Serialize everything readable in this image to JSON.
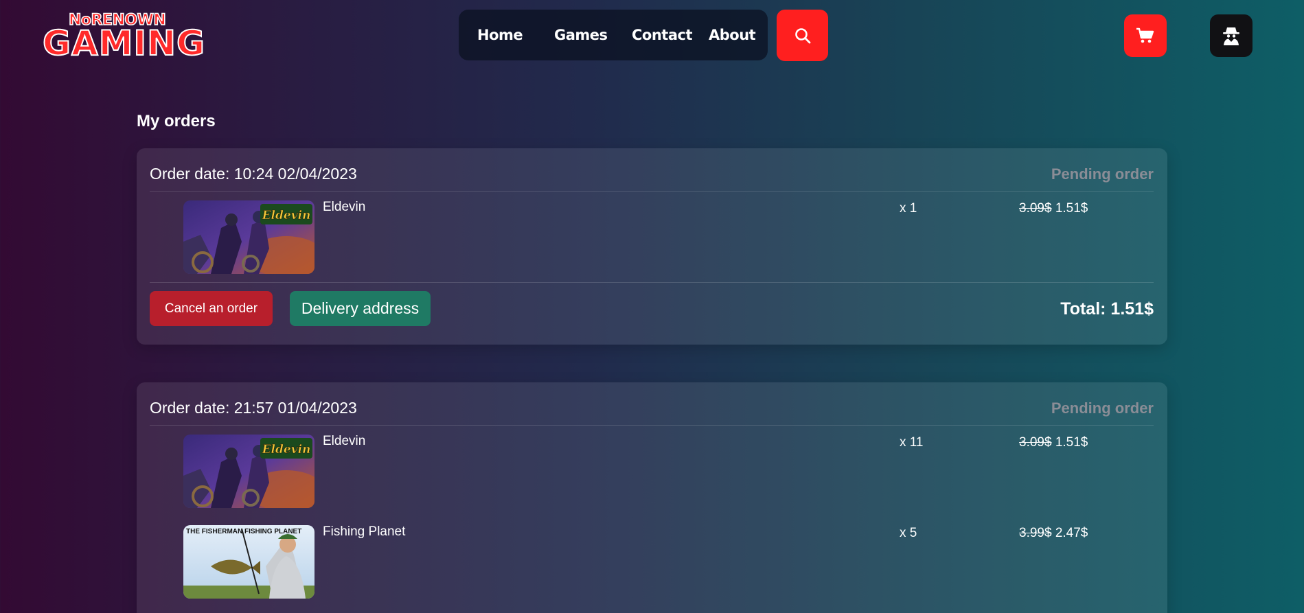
{
  "brand": {
    "top": "NoRENOWN",
    "main": "GAMING"
  },
  "nav": {
    "items": [
      {
        "label": "Home"
      },
      {
        "label": "Games"
      },
      {
        "label": "Contact"
      },
      {
        "label": "About"
      }
    ],
    "search_icon": "search-icon",
    "cart_icon": "cart-icon",
    "user_icon": "spy-user-icon"
  },
  "colors": {
    "accent": "#ff1f1f",
    "cancel": "#b81f2c",
    "delivery": "#1f7a64",
    "status": "#8a8d96"
  },
  "page": {
    "title": "My orders"
  },
  "orders": [
    {
      "date": "Order date: 10:24 02/04/2023",
      "status": "Pending order",
      "items": [
        {
          "name": "Eldevin",
          "image_label": "Eldevin",
          "qty": "x 1",
          "old_price": "3.09$",
          "price": " 1.51$"
        }
      ],
      "cancel_label": "Cancel an order",
      "delivery_label": "Delivery address",
      "total": "Total: 1.51$"
    },
    {
      "date": "Order date: 21:57 01/04/2023",
      "status": "Pending order",
      "items": [
        {
          "name": "Eldevin",
          "image_label": "Eldevin",
          "qty": "x 11",
          "old_price": "3.09$",
          "price": " 1.51$"
        },
        {
          "name": "Fishing Planet",
          "image_label": "THE FISHERMAN FISHING PLANET",
          "qty": "x 5",
          "old_price": "3.99$",
          "price": " 2.47$"
        }
      ]
    }
  ]
}
